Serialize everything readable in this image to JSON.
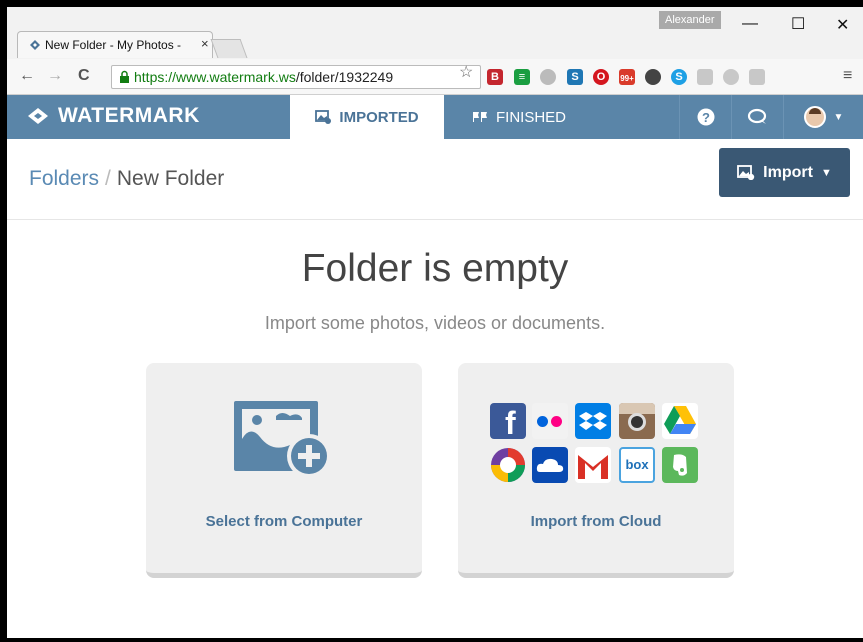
{
  "browser": {
    "tab_title": "New Folder - My Photos - ",
    "tab_close": "×",
    "profile_name": "Alexander",
    "win_minimize": "—",
    "win_maximize": "☐",
    "win_close": "✕",
    "url_host": "https://www.watermark.ws",
    "url_path": "/folder/1932249",
    "extension_badge": "99+"
  },
  "app": {
    "logo_text": "WATERMARK",
    "tabs": [
      {
        "label": "IMPORTED",
        "icon": "images-icon",
        "active": true
      },
      {
        "label": "FINISHED",
        "icon": "flags-icon",
        "active": false
      }
    ],
    "help_icon": "question-icon",
    "chat_icon": "chat-icon"
  },
  "breadcrumb": {
    "root": "Folders",
    "separator": "/",
    "current": "New Folder"
  },
  "import_button": {
    "label": "Import",
    "icon": "images-icon"
  },
  "empty_state": {
    "title": "Folder is empty",
    "subtitle": "Import some photos, videos or documents."
  },
  "cards": [
    {
      "label": "Select from Computer",
      "icon": "add-image-icon"
    },
    {
      "label": "Import from Cloud",
      "services": [
        "facebook",
        "flickr",
        "dropbox",
        "instagram",
        "google-drive",
        "picasa",
        "onedrive",
        "gmail",
        "box",
        "evernote"
      ],
      "service_labels": {
        "facebook": "f",
        "box": "box"
      }
    }
  ],
  "colors": {
    "nav_bg": "#5a85a8",
    "active_tab_text": "#4a7397",
    "import_button_bg": "#3a5874",
    "card_bg": "#efefef",
    "link": "#5a8ab4"
  }
}
